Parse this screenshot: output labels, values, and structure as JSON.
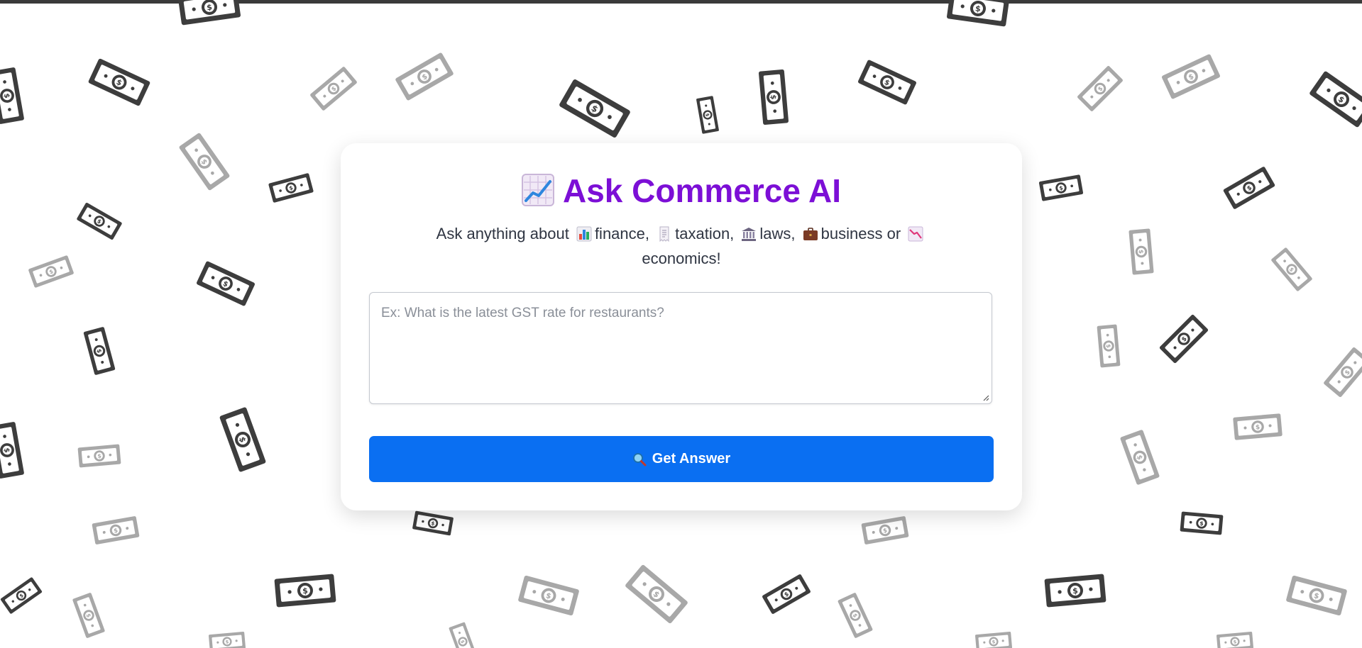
{
  "app": {
    "title_icon": "chart-increasing-icon",
    "title": "Ask Commerce AI",
    "subtitle": {
      "prefix": "Ask anything about",
      "topics": [
        {
          "icon": "bar-chart-icon",
          "label": "finance,"
        },
        {
          "icon": "receipt-icon",
          "label": "taxation,"
        },
        {
          "icon": "classical-building-icon",
          "label": "laws,"
        },
        {
          "icon": "briefcase-icon",
          "label": "business or"
        },
        {
          "icon": "chart-decreasing-icon",
          "label": "economics!"
        }
      ]
    },
    "question": {
      "placeholder": "Ex: What is the latest GST rate for restaurants?",
      "value": ""
    },
    "submit_button": {
      "icon": "magnifying-glass-icon",
      "label": "Get Answer"
    }
  },
  "colors": {
    "title": "#7c0fd6",
    "button": "#0a6ff2",
    "subtitle_text": "#2f3542",
    "top_bar": "#3a3a3a",
    "money_dark": "#3d3d3d",
    "money_light": "#a8a8a8"
  },
  "background": {
    "pattern": "scattered-dollar-bills",
    "icon": "dollar-bill-icon"
  }
}
